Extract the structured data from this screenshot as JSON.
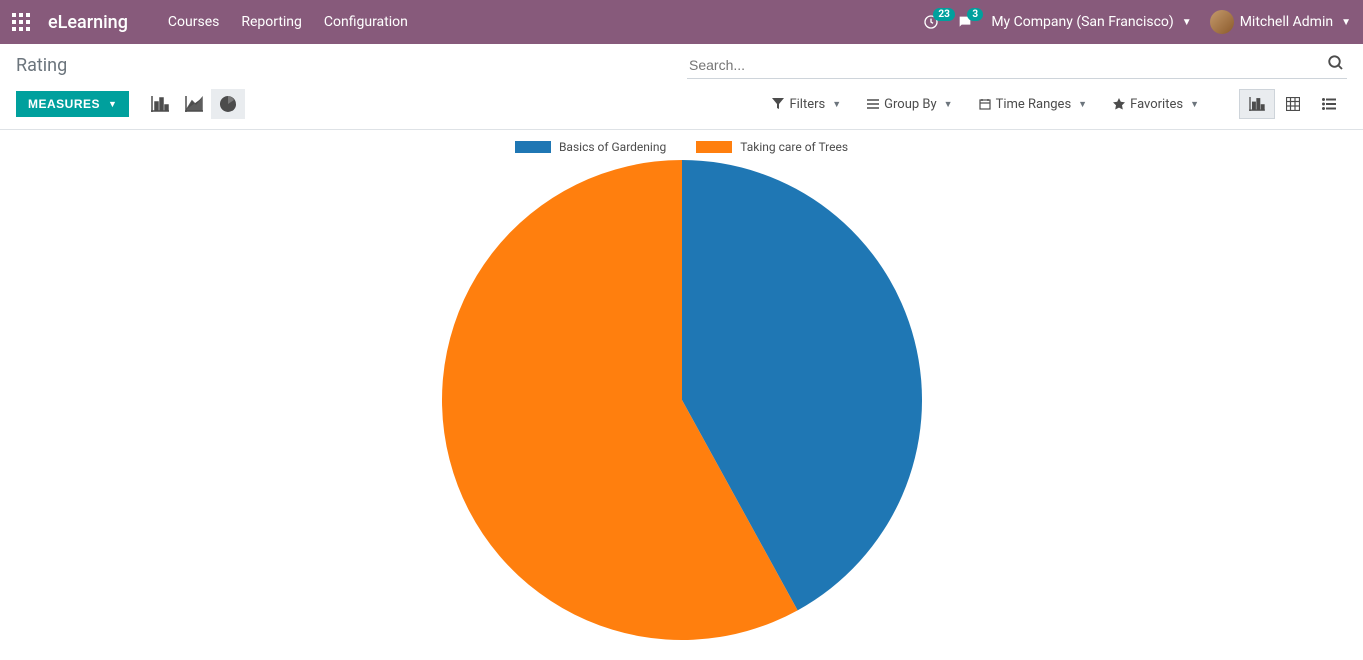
{
  "navbar": {
    "brand": "eLearning",
    "menu": [
      "Courses",
      "Reporting",
      "Configuration"
    ],
    "activity_count": "23",
    "messages_count": "3",
    "company": "My Company (San Francisco)",
    "user": "Mitchell Admin"
  },
  "breadcrumb": "Rating",
  "search": {
    "placeholder": "Search..."
  },
  "buttons": {
    "measures": "MEASURES"
  },
  "search_options": {
    "filters": "Filters",
    "group_by": "Group By",
    "time_ranges": "Time Ranges",
    "favorites": "Favorites"
  },
  "chart_data": {
    "type": "pie",
    "title": "",
    "series": [
      {
        "name": "Basics of Gardening",
        "value": 42,
        "color": "#1f77b4"
      },
      {
        "name": "Taking care of Trees",
        "value": 58,
        "color": "#ff7f0e"
      }
    ]
  }
}
